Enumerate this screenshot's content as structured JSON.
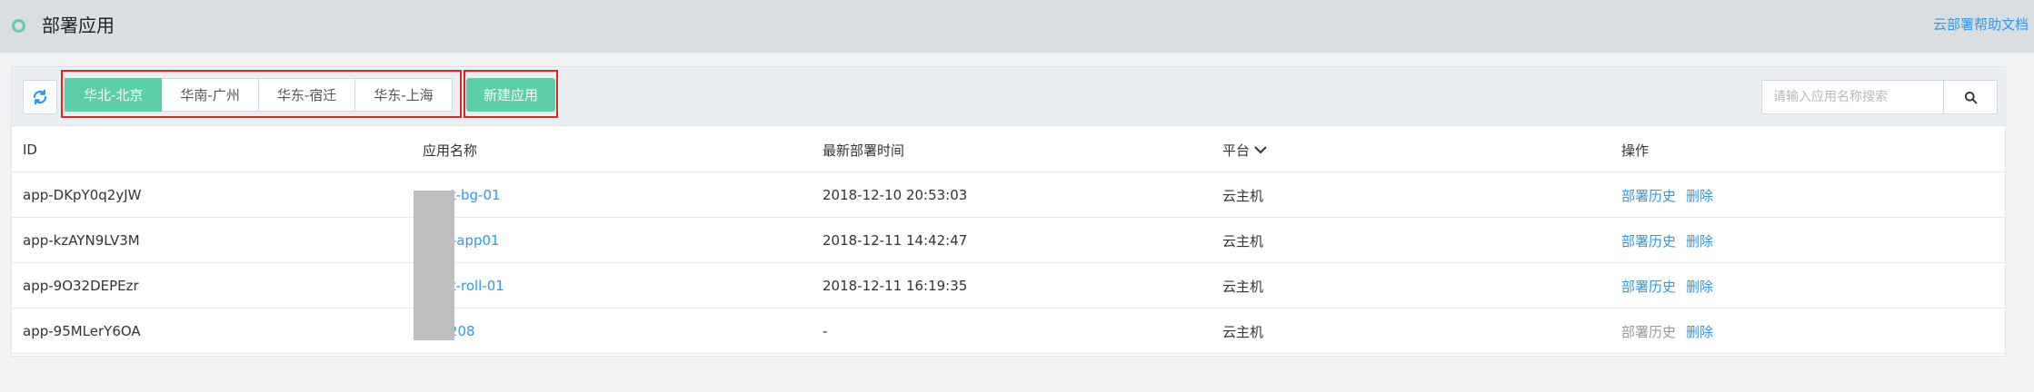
{
  "header": {
    "title": "部署应用",
    "help_link": "云部署帮助文档"
  },
  "toolbar": {
    "regions": [
      "华北-北京",
      "华南-广州",
      "华东-宿迁",
      "华东-上海"
    ],
    "create_label": "新建应用",
    "search_placeholder": "请输入应用名称搜索"
  },
  "table": {
    "columns": [
      "ID",
      "应用名称",
      "最新部署时间",
      "平台",
      "操作"
    ],
    "rows": [
      {
        "id": "app-DKpY0q2yJW",
        "name": "v      est-bg-01",
        "time": "2018-12-10 20:53:03",
        "platform": "云主机",
        "history": "部署历史",
        "delete": "删除"
      },
      {
        "id": "app-kzAYN9LV3M",
        "name": "l      est-app01",
        "time": "2018-12-11 14:42:47",
        "platform": "云主机",
        "history": "部署历史",
        "delete": "删除"
      },
      {
        "id": "app-9O32DEPEzr",
        "name": "v      est-roll-01",
        "time": "2018-12-11 16:19:35",
        "platform": "云主机",
        "history": "部署历史",
        "delete": "删除"
      },
      {
        "id": "app-95MLerY6OA",
        "name": "a      -1208",
        "time": "-",
        "platform": "云主机",
        "history": "部署历史",
        "delete": "删除"
      }
    ]
  },
  "colors": {
    "accent": "#5ccfa9",
    "link": "#2b9be8",
    "highlight": "#e02424",
    "disabled": "#999999"
  },
  "icons": {
    "status": "ring-icon",
    "refresh": "refresh-icon",
    "search": "search-icon",
    "sort": "chevron-down-icon"
  }
}
